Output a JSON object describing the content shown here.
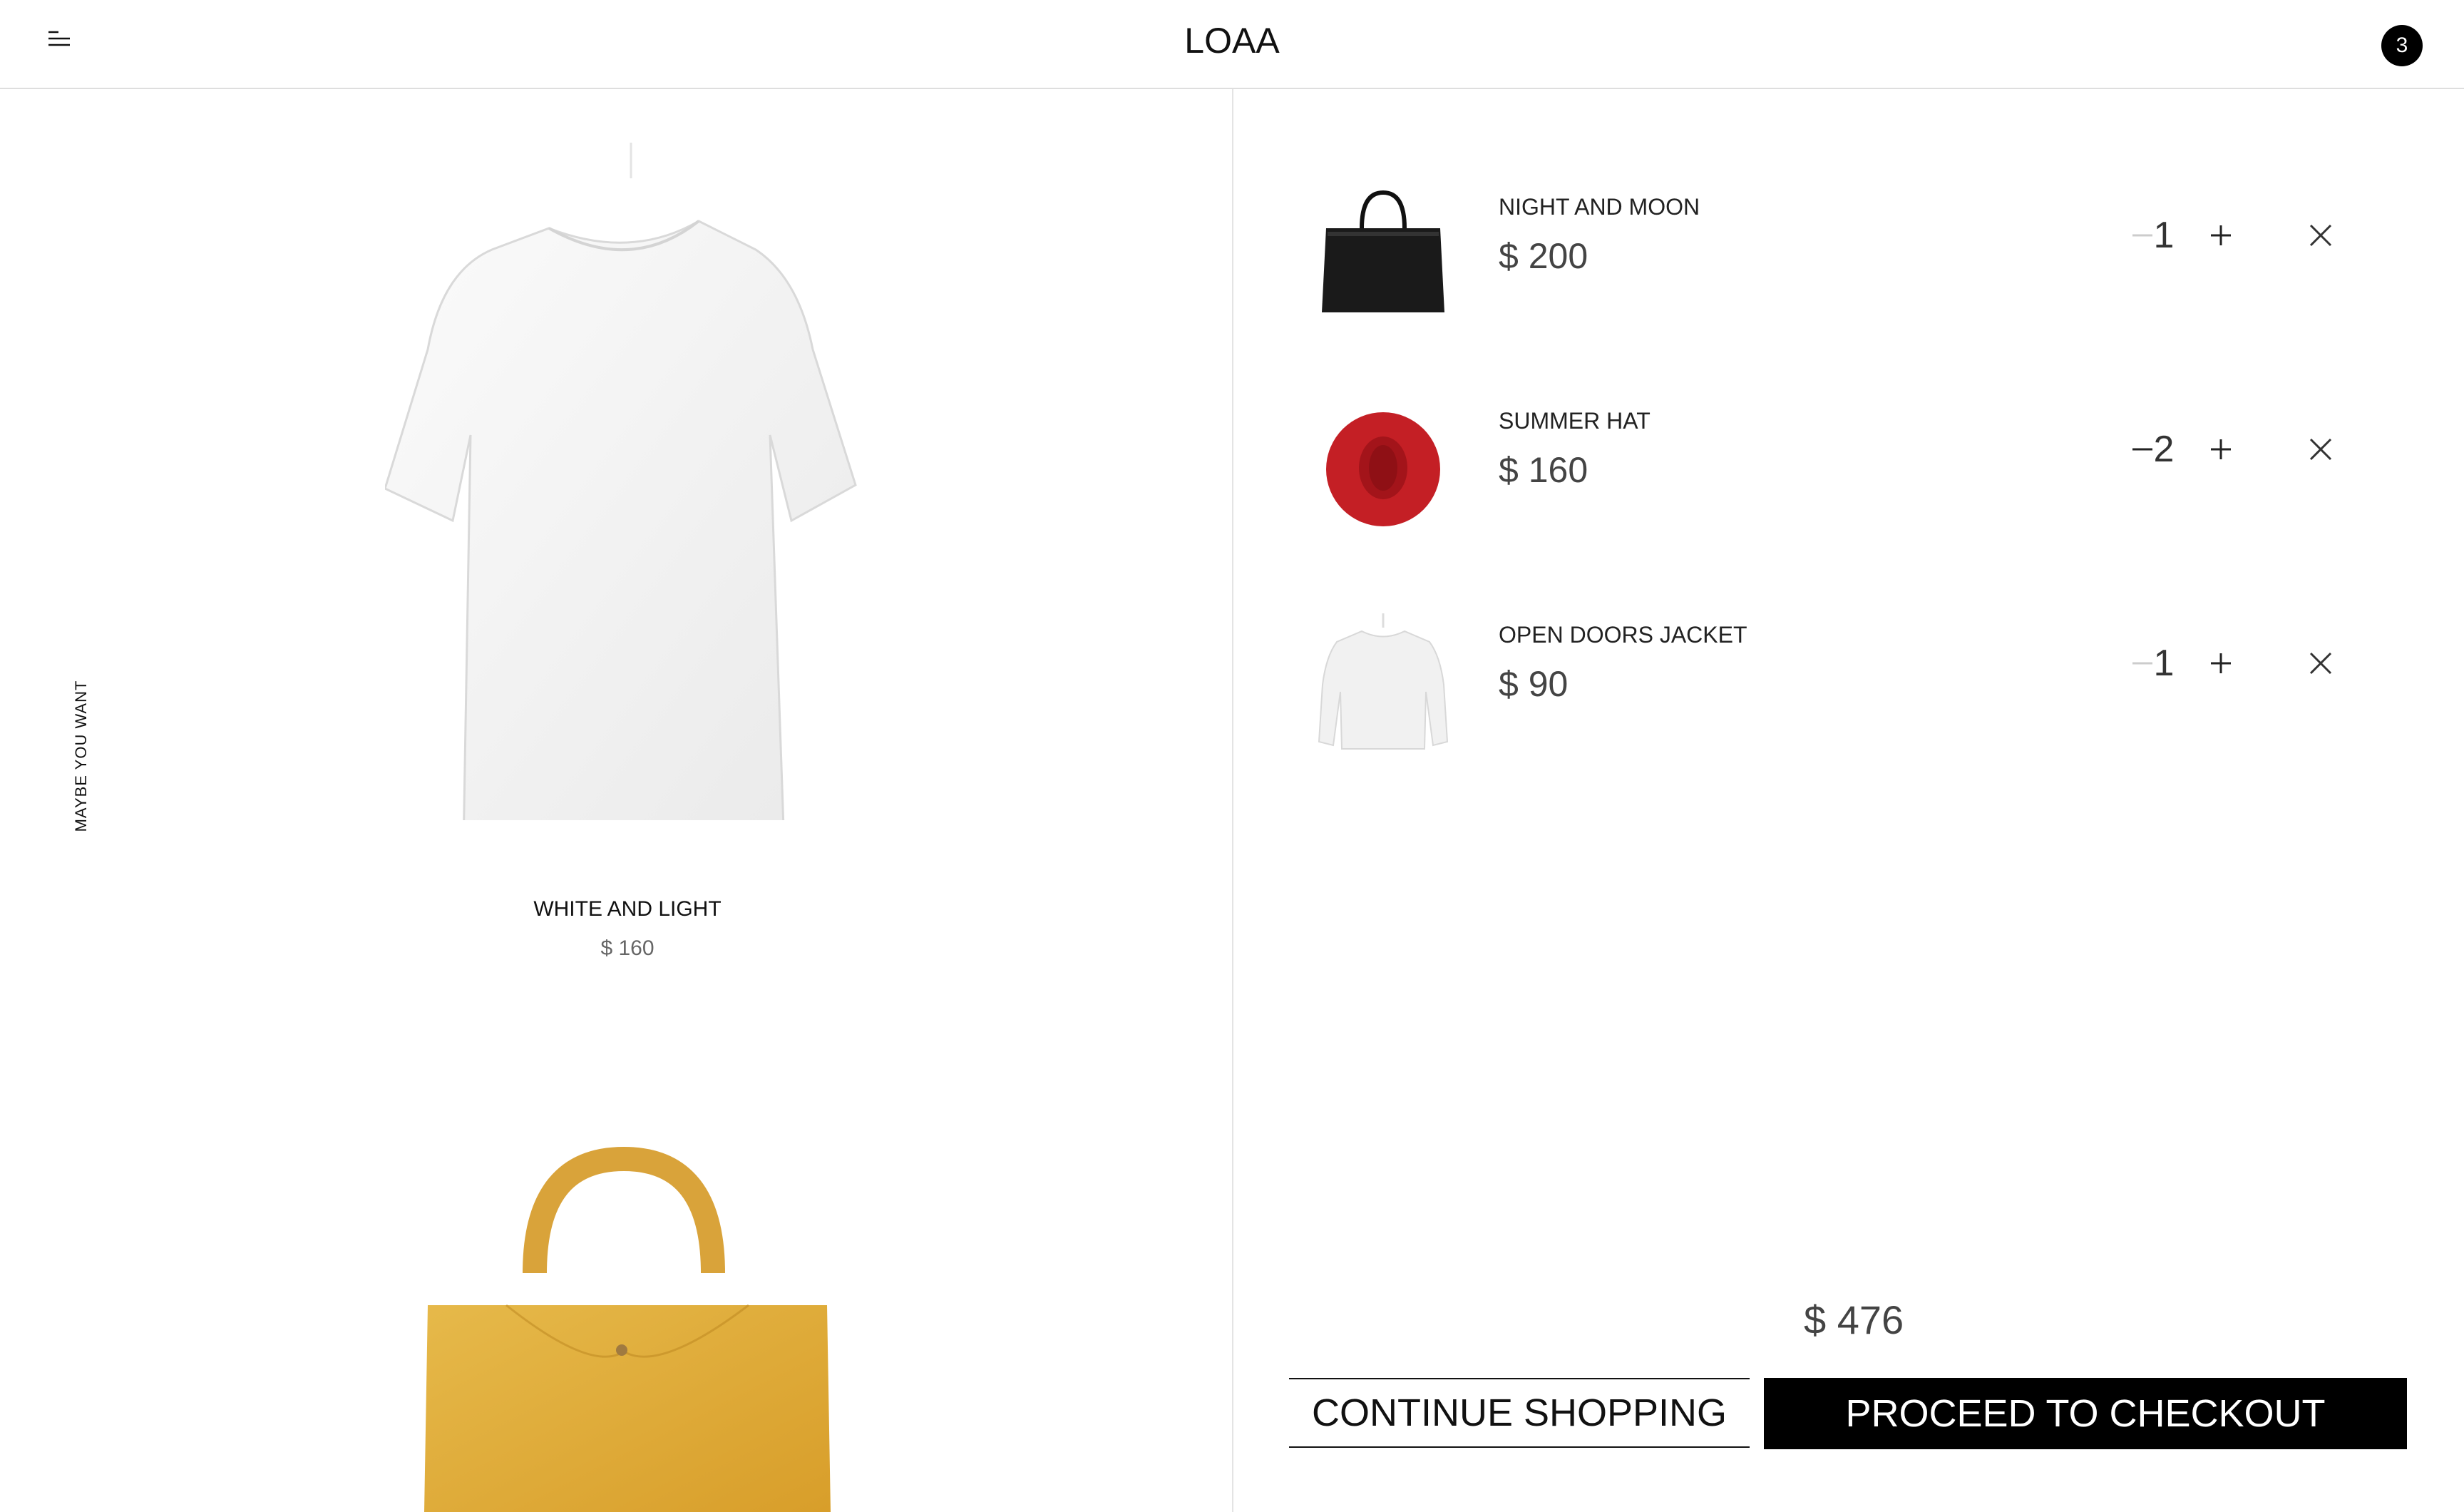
{
  "header": {
    "logo_letters": [
      "L",
      "O",
      "A",
      "A"
    ],
    "cart_count": "3",
    "menu_icon": "hamburger-menu-icon"
  },
  "suggestions": {
    "side_label": "MAYBE YOU WANT",
    "items": [
      {
        "name": "WHITE AND LIGHT",
        "price": "$ 160"
      }
    ]
  },
  "cart": {
    "items": [
      {
        "name": "NIGHT AND MOON",
        "price": "$ 200",
        "quantity": "1"
      },
      {
        "name": "SUMMER HAT",
        "price": "$ 160",
        "quantity": "2"
      },
      {
        "name": "OPEN DOORS JACKET",
        "price": "$ 90",
        "quantity": "1"
      }
    ],
    "total": "$ 476",
    "continue_label": "CONTINUE SHOPPING",
    "checkout_label": "PROCEED TO CHECKOUT"
  }
}
